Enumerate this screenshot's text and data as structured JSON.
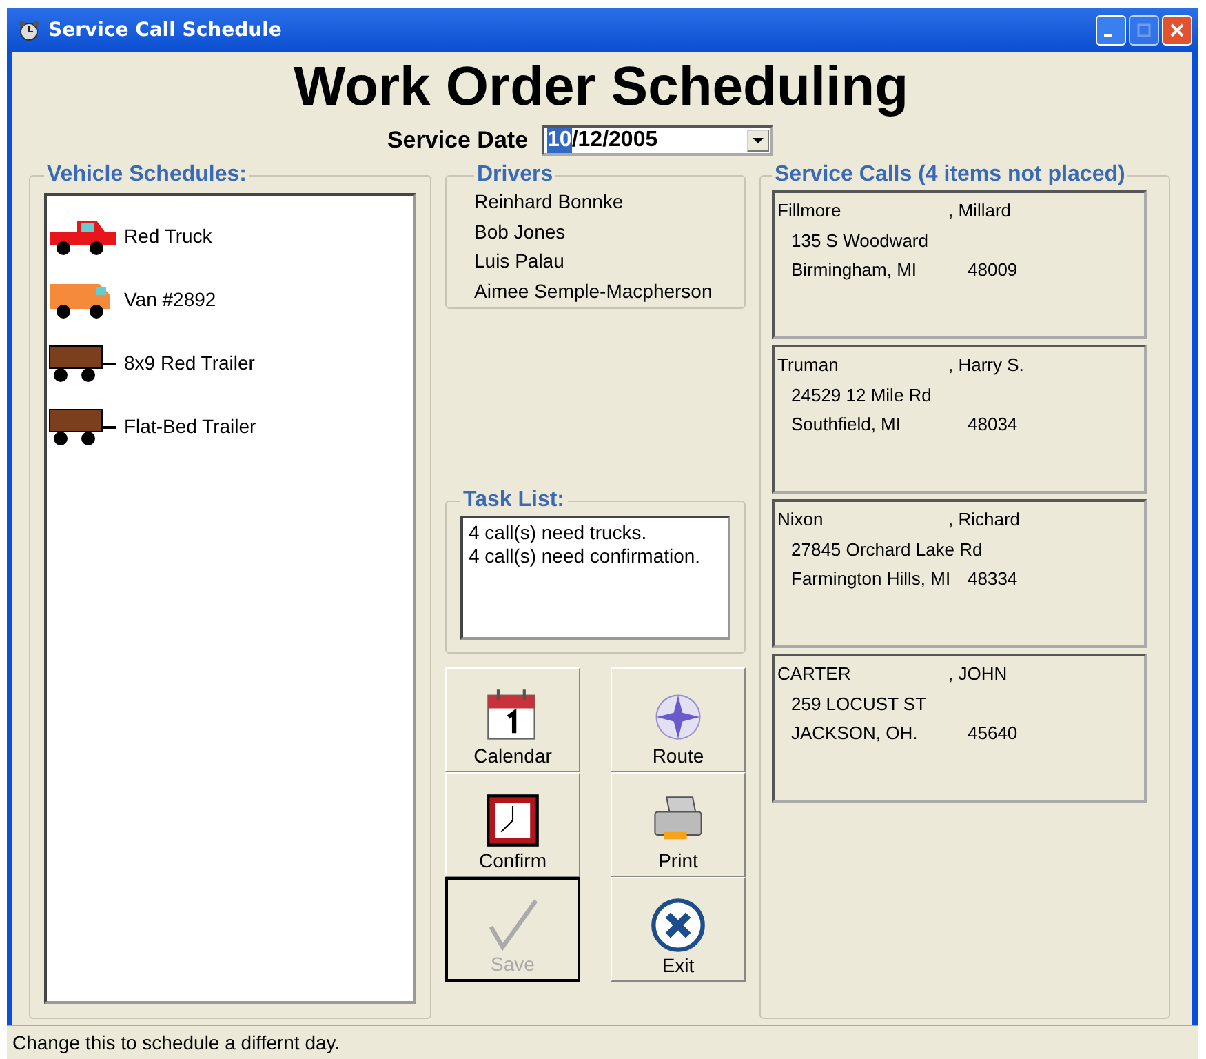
{
  "window": {
    "title": "Service Call Schedule"
  },
  "heading": "Work Order Scheduling",
  "service_date": {
    "label": "Service Date",
    "selected_part": "10",
    "rest": "/12/2005"
  },
  "vehicle_schedules": {
    "title": "Vehicle Schedules:",
    "items": [
      {
        "kind": "truck",
        "label": "Red Truck"
      },
      {
        "kind": "van",
        "label": "Van #2892"
      },
      {
        "kind": "trailer",
        "label": "8x9 Red Trailer"
      },
      {
        "kind": "trailer",
        "label": "Flat-Bed Trailer"
      }
    ]
  },
  "drivers": {
    "title": "Drivers",
    "items": [
      "Reinhard Bonnke",
      "Bob Jones",
      "Luis Palau",
      "Aimee Semple-Macpherson"
    ]
  },
  "task_list": {
    "title": "Task List:",
    "items": [
      "4 call(s) need trucks.",
      "4 call(s) need confirmation."
    ]
  },
  "buttons": [
    {
      "kind": "calendar",
      "label": "Calendar",
      "disabled": false,
      "default": false
    },
    {
      "kind": "route",
      "label": "Route",
      "disabled": false,
      "default": false
    },
    {
      "kind": "confirm",
      "label": "Confirm",
      "disabled": false,
      "default": false
    },
    {
      "kind": "print",
      "label": "Print",
      "disabled": false,
      "default": false
    },
    {
      "kind": "save",
      "label": "Save",
      "disabled": true,
      "default": true
    },
    {
      "kind": "exit",
      "label": "Exit",
      "disabled": false,
      "default": false
    }
  ],
  "service_calls": {
    "title": "Service Calls (4 items not placed)",
    "items": [
      {
        "last": "Fillmore",
        "first": ", Millard",
        "street": "135 S Woodward",
        "city": "Birmingham, MI",
        "zip": "48009"
      },
      {
        "last": "Truman",
        "first": ", Harry S.",
        "street": "24529 12 Mile Rd",
        "city": "Southfield, MI",
        "zip": "48034"
      },
      {
        "last": "Nixon",
        "first": ", Richard",
        "street": "27845 Orchard Lake Rd",
        "city": "Farmington Hills, MI",
        "zip": "48334"
      },
      {
        "last": "CARTER",
        "first": ", JOHN",
        "street": "259 LOCUST ST",
        "city": "JACKSON, OH.",
        "zip": "45640"
      }
    ]
  },
  "status_bar": "Change this to schedule a differnt day."
}
